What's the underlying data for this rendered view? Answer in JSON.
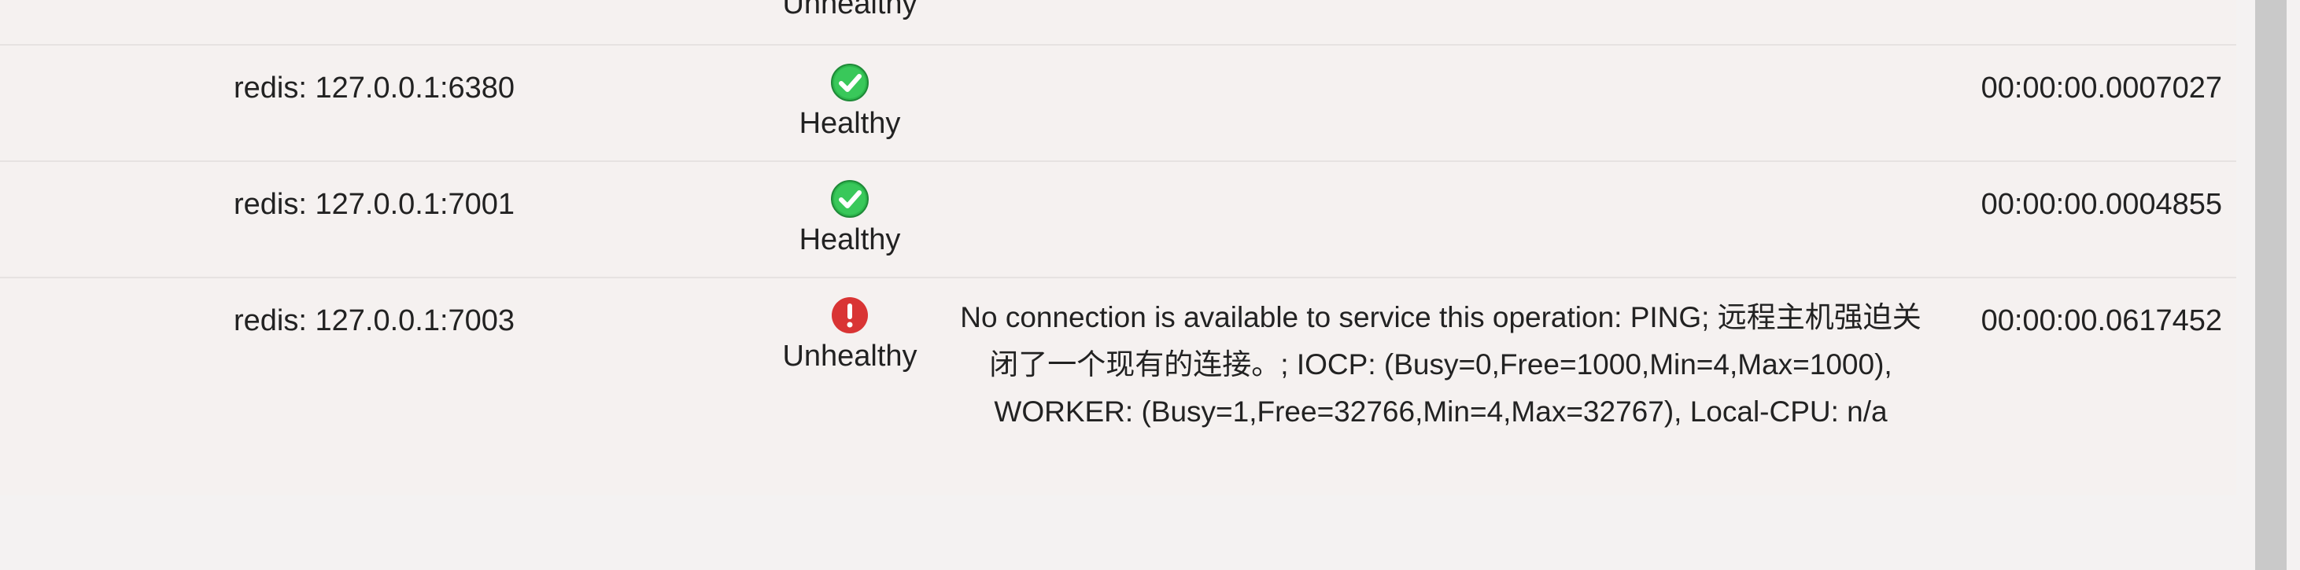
{
  "rows": [
    {
      "name": "",
      "status": "Unhealthy",
      "description": "",
      "duration": ""
    },
    {
      "name": "redis: 127.0.0.1:6380",
      "status": "Healthy",
      "status_icon": "check-circle-icon",
      "description": "",
      "duration": "00:00:00.0007027"
    },
    {
      "name": "redis: 127.0.0.1:7001",
      "status": "Healthy",
      "status_icon": "check-circle-icon",
      "description": "",
      "duration": "00:00:00.0004855"
    },
    {
      "name": "redis: 127.0.0.1:7003",
      "status": "Unhealthy",
      "status_icon": "error-circle-icon",
      "description": "No connection is available to service this operation: PING; 远程主机强迫关闭了一个现有的连接。; IOCP: (Busy=0,Free=1000,Min=4,Max=1000), WORKER: (Busy=1,Free=32766,Min=4,Max=32767), Local-CPU: n/a",
      "duration": "00:00:00.0617452"
    }
  ],
  "colors": {
    "healthy": "#2db84d",
    "unhealthy": "#d93434",
    "row_background": "#f5f1f0",
    "divider": "#e6e2e1"
  }
}
